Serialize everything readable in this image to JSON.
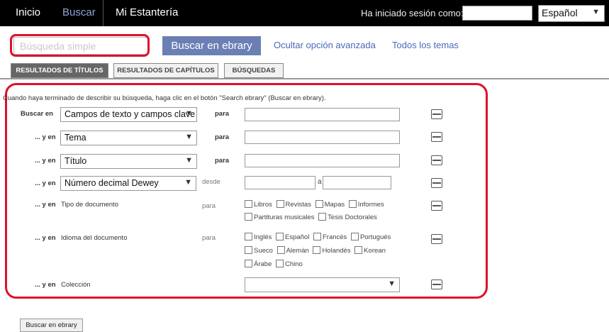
{
  "nav": {
    "inicio": "Inicio",
    "buscar": "Buscar",
    "estanteria": "Mi Estantería",
    "login_label": "Ha iniciado sesión como:",
    "login_value": "",
    "language": "Español"
  },
  "search": {
    "placeholder": "Búsqueda simple",
    "button": "Buscar en ebrary",
    "hide_advanced": "Ocultar opción avanzada",
    "all_topics": "Todos los temas"
  },
  "tabs": [
    "RESULTADOS DE TÍTULOS",
    "RESULTADOS DE CAPÍTULOS",
    "BÚSQUEDAS"
  ],
  "form": {
    "instructions": "Cuando haya terminado de describir su búsqueda, haga clic en el botón \"Search ebrary\" (Buscar en ebrary).",
    "rows": [
      {
        "label": "Buscar en",
        "select": "Campos de texto y campos clave",
        "connector": "para"
      },
      {
        "label": "... y en",
        "select": "Tema",
        "connector": "para"
      },
      {
        "label": "... y en",
        "select": "Título",
        "connector": "para"
      },
      {
        "label": "... y en",
        "select": "Número decimal Dewey",
        "connector": "desde",
        "range_sep": "a"
      }
    ],
    "doc_type": {
      "label": "... y en",
      "field": "Tipo de documento",
      "connector": "para",
      "options": [
        "Libros",
        "Revistas",
        "Mapas",
        "Informes",
        "Partituras musicales",
        "Tesis Doctorales"
      ]
    },
    "language": {
      "label": "... y en",
      "field": "Idioma del documento",
      "connector": "para",
      "options": [
        "Inglés",
        "Español",
        "Francés",
        "Portugués",
        "Sueco",
        "Alemán",
        "Holandés",
        "Korean",
        "Árabe",
        "Chino"
      ]
    },
    "collection": {
      "label": "... y en",
      "field": "Colección",
      "value": ""
    },
    "submit": "Buscar en ebrary"
  },
  "colors": {
    "accent_red": "#e0102a",
    "button_blue": "#6c7fb5",
    "link_blue": "#4a69b8"
  }
}
